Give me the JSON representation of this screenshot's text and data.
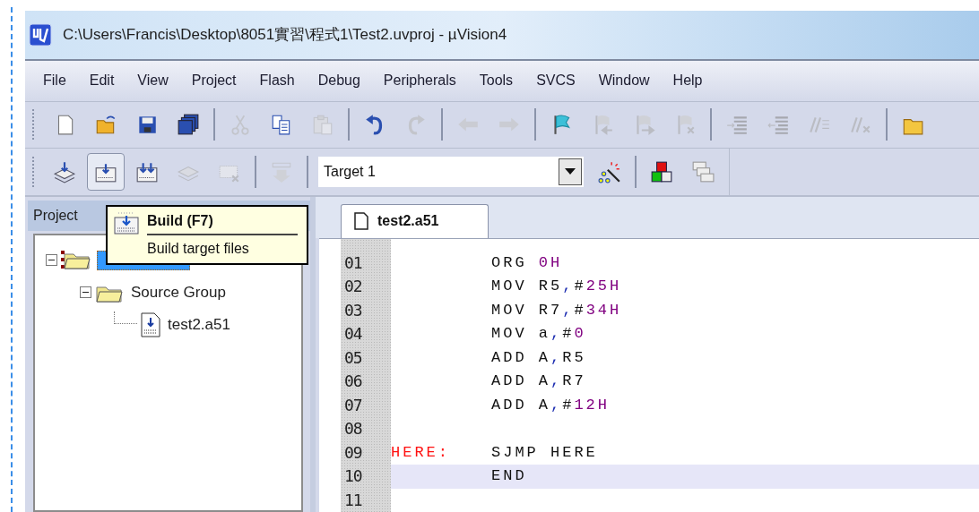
{
  "window": {
    "title": "C:\\Users\\Francis\\Desktop\\8051實習\\程式1\\Test2.uvproj - µVision4"
  },
  "menu": [
    "File",
    "Edit",
    "View",
    "Project",
    "Flash",
    "Debug",
    "Peripherals",
    "Tools",
    "SVCS",
    "Window",
    "Help"
  ],
  "toolbar_1": [
    {
      "kind": "new",
      "disabled": false
    },
    {
      "kind": "open",
      "disabled": false
    },
    {
      "kind": "save",
      "disabled": false
    },
    {
      "kind": "saveall",
      "disabled": false
    },
    {
      "kind": "separator"
    },
    {
      "kind": "cut",
      "disabled": true
    },
    {
      "kind": "copy",
      "disabled": false
    },
    {
      "kind": "paste",
      "disabled": true
    },
    {
      "kind": "separator"
    },
    {
      "kind": "undo",
      "disabled": false
    },
    {
      "kind": "redo",
      "disabled": true
    },
    {
      "kind": "separator"
    },
    {
      "kind": "back",
      "disabled": true
    },
    {
      "kind": "forward",
      "disabled": true
    },
    {
      "kind": "separator"
    },
    {
      "kind": "bookmark",
      "disabled": false
    },
    {
      "kind": "prevmark",
      "disabled": true
    },
    {
      "kind": "nextmark",
      "disabled": true
    },
    {
      "kind": "clearmarks",
      "disabled": true
    },
    {
      "kind": "separator"
    },
    {
      "kind": "indent",
      "disabled": true
    },
    {
      "kind": "unindent",
      "disabled": true
    },
    {
      "kind": "comment",
      "disabled": true
    },
    {
      "kind": "uncomment",
      "disabled": true
    },
    {
      "kind": "separator"
    },
    {
      "kind": "folder",
      "disabled": false
    }
  ],
  "toolbar_2": [
    {
      "kind": "translate",
      "disabled": false,
      "pressed": false
    },
    {
      "kind": "build",
      "disabled": false,
      "pressed": true
    },
    {
      "kind": "rebuild",
      "disabled": false,
      "pressed": false
    },
    {
      "kind": "batch",
      "disabled": true,
      "pressed": false
    },
    {
      "kind": "stop",
      "disabled": true,
      "pressed": false
    },
    {
      "kind": "separator"
    },
    {
      "kind": "load",
      "disabled": true,
      "pressed": false
    },
    {
      "kind": "separator"
    },
    {
      "kind": "target",
      "value": "Target 1"
    },
    {
      "kind": "wizard",
      "disabled": false,
      "pressed": false
    },
    {
      "kind": "separator"
    },
    {
      "kind": "components",
      "disabled": false,
      "pressed": false
    },
    {
      "kind": "windows",
      "disabled": false,
      "pressed": false
    }
  ],
  "project_panel": {
    "title": "Project",
    "tree": [
      {
        "kind": "target",
        "expanded": true,
        "selected": true,
        "children": [
          {
            "kind": "group",
            "label": "Source Group",
            "expanded": true,
            "selected": false,
            "children": [
              {
                "kind": "file",
                "label": "test2.a51",
                "selected": false
              }
            ]
          }
        ]
      }
    ]
  },
  "tooltip": {
    "title": "Build (F7)",
    "description": "Build target files"
  },
  "editor": {
    "tabs": [
      {
        "label": "test2.a51",
        "selected": true
      }
    ],
    "lines": [
      {
        "number": "01",
        "current": false,
        "code": [
          {
            "kind": "plain",
            "text": "ORG "
          },
          {
            "kind": "number",
            "text": "0H"
          }
        ]
      },
      {
        "number": "02",
        "current": false,
        "code": [
          {
            "kind": "plain",
            "text": "MOV R5"
          },
          {
            "kind": "punct",
            "text": ","
          },
          {
            "kind": "plain",
            "text": "#"
          },
          {
            "kind": "number",
            "text": "25H"
          }
        ]
      },
      {
        "number": "03",
        "current": false,
        "code": [
          {
            "kind": "plain",
            "text": "MOV R7"
          },
          {
            "kind": "punct",
            "text": ","
          },
          {
            "kind": "plain",
            "text": "#"
          },
          {
            "kind": "number",
            "text": "34H"
          }
        ]
      },
      {
        "number": "04",
        "current": false,
        "code": [
          {
            "kind": "plain",
            "text": "MOV a"
          },
          {
            "kind": "punct",
            "text": ","
          },
          {
            "kind": "plain",
            "text": "#"
          },
          {
            "kind": "number",
            "text": "0"
          }
        ]
      },
      {
        "number": "05",
        "current": false,
        "code": [
          {
            "kind": "plain",
            "text": "ADD A"
          },
          {
            "kind": "punct",
            "text": ","
          },
          {
            "kind": "plain",
            "text": "R5"
          }
        ]
      },
      {
        "number": "06",
        "current": false,
        "code": [
          {
            "kind": "plain",
            "text": "ADD A"
          },
          {
            "kind": "punct",
            "text": ","
          },
          {
            "kind": "plain",
            "text": "R7"
          }
        ]
      },
      {
        "number": "07",
        "current": false,
        "code": [
          {
            "kind": "plain",
            "text": "ADD A"
          },
          {
            "kind": "punct",
            "text": ","
          },
          {
            "kind": "plain",
            "text": "#"
          },
          {
            "kind": "number",
            "text": "12H"
          }
        ]
      },
      {
        "number": "08",
        "current": false
      },
      {
        "number": "09",
        "label": "HERE:",
        "current": false,
        "code": [
          {
            "kind": "plain",
            "text": "SJMP HERE"
          }
        ]
      },
      {
        "number": "10",
        "current": true,
        "code": [
          {
            "kind": "plain",
            "text": "END"
          }
        ]
      },
      {
        "number": "11",
        "current": false
      }
    ]
  }
}
